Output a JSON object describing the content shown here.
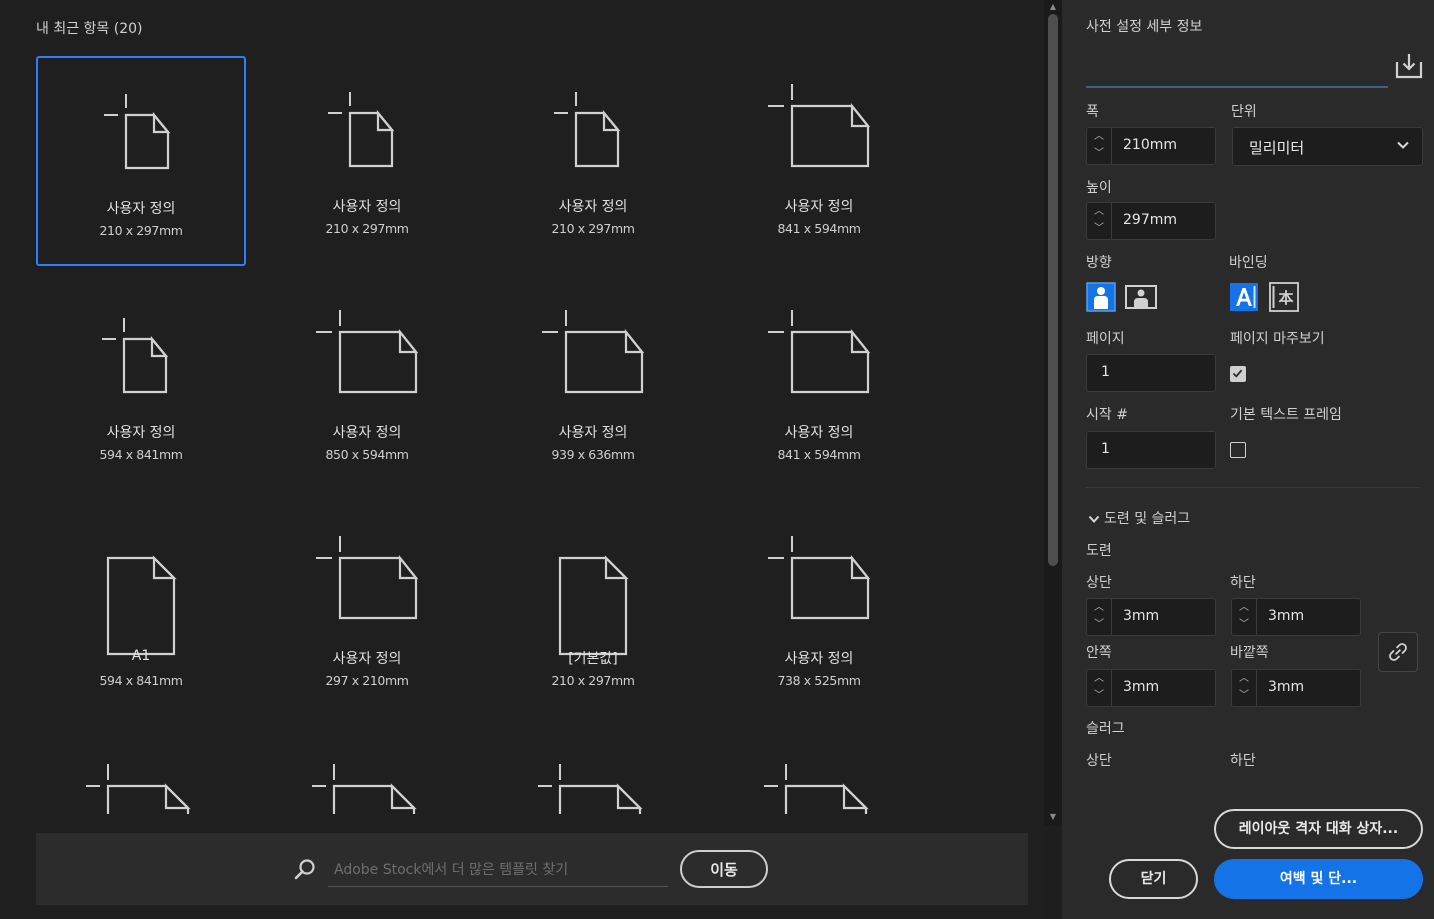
{
  "recent": {
    "title": "내 최근 항목  (20)"
  },
  "presets": [
    {
      "name": "사용자 정의",
      "size": "210 x 297mm",
      "selected": true
    },
    {
      "name": "사용자 정의",
      "size": "210 x 297mm"
    },
    {
      "name": "사용자 정의",
      "size": "210 x 297mm"
    },
    {
      "name": "사용자 정의",
      "size": "841 x 594mm"
    },
    {
      "name": "사용자 정의",
      "size": "594 x 841mm"
    },
    {
      "name": "사용자 정의",
      "size": "850 x 594mm"
    },
    {
      "name": "사용자 정의",
      "size": "939 x 636mm"
    },
    {
      "name": "사용자 정의",
      "size": "841 x 594mm"
    },
    {
      "name": "A1",
      "size": "594 x 841mm"
    },
    {
      "name": "사용자 정의",
      "size": "297 x 210mm"
    },
    {
      "name": "[기본값]",
      "size": "210 x 297mm"
    },
    {
      "name": "사용자 정의",
      "size": "738 x 525mm"
    }
  ],
  "search": {
    "placeholder": "Adobe Stock에서 더 많은 템플릿 찾기",
    "go_label": "이동"
  },
  "details": {
    "title": "사전 설정 세부 정보",
    "width_label": "폭",
    "width_value": "210mm",
    "units_label": "단위",
    "units_value": "밀리미터",
    "height_label": "높이",
    "height_value": "297mm",
    "orientation_label": "방향",
    "binding_label": "바인딩",
    "pages_label": "페이지",
    "pages_value": "1",
    "facing_label": "페이지 마주보기",
    "start_label": "시작 #",
    "start_value": "1",
    "primary_frame_label": "기본 텍스트 프레임",
    "bleed_slug_label": "도련 및 슬러그",
    "bleed_label": "도련",
    "top_label": "상단",
    "top_value": "3mm",
    "bottom_label": "하단",
    "bottom_value": "3mm",
    "inside_label": "안쪽",
    "inside_value": "3mm",
    "outside_label": "바깥쪽",
    "outside_value": "3mm",
    "slug_label": "슬러그",
    "slug_top_label": "상단",
    "slug_bottom_label": "하단"
  },
  "buttons": {
    "layout_grid": "레이아웃 격자 대화 상자...",
    "close": "닫기",
    "margins": "여백 및 단..."
  },
  "colors": {
    "accent": "#1473e6",
    "selected_border": "#2d7ff9"
  }
}
